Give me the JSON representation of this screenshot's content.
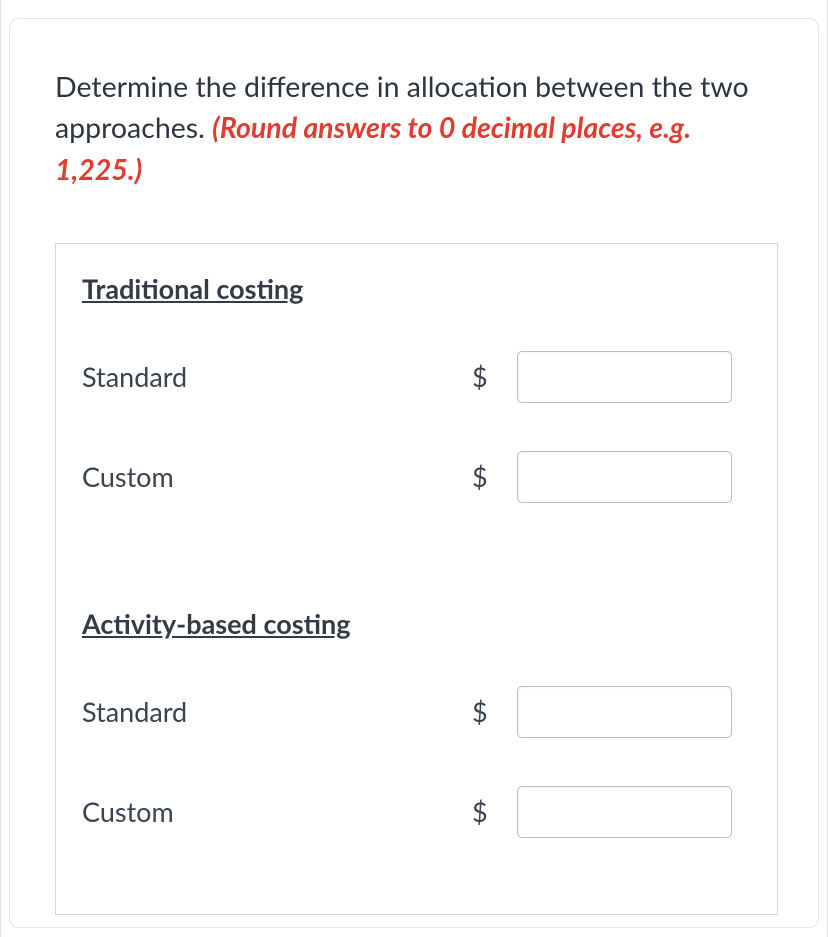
{
  "instruction": {
    "text": "Determine the difference in allocation between the two approaches. ",
    "hint": "(Round answers to 0 decimal places, e.g. 1,225.)"
  },
  "sections": {
    "traditional": {
      "title": "Traditional costing",
      "rows": {
        "standard": {
          "label": "Standard",
          "symbol": "$",
          "value": ""
        },
        "custom": {
          "label": "Custom",
          "symbol": "$",
          "value": ""
        }
      }
    },
    "activity": {
      "title": "Activity-based costing",
      "rows": {
        "standard": {
          "label": "Standard",
          "symbol": "$",
          "value": ""
        },
        "custom": {
          "label": "Custom",
          "symbol": "$",
          "value": ""
        }
      }
    }
  }
}
